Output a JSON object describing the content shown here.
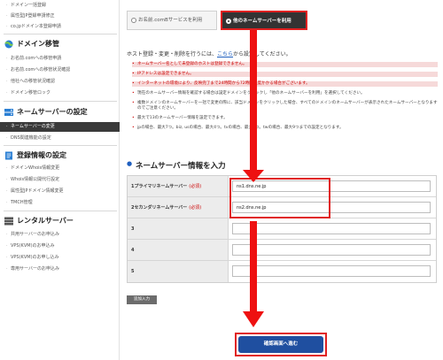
{
  "sidebar": {
    "top_items": [
      "ドメイン一括登録",
      "属性型JP登録申請修正",
      "co.jpドメイン本登録申請"
    ],
    "domain_transfer": {
      "heading": "ドメイン移管",
      "items": [
        "お名前.comへの移管申請",
        "お名前.comへの移管状況確認",
        "他社への移管状況確認",
        "ドメイン移管ロック"
      ]
    },
    "nameserver": {
      "heading": "ネームサーバーの設定",
      "active_item": "ネームサーバーの変更",
      "items": [
        "DNS関連機能の設定"
      ]
    },
    "registration": {
      "heading": "登録情報の設定",
      "items": [
        "ドメインWhois情報変更",
        "Whois情報公開代行設定",
        "属性型JPドメイン情報変更",
        "TMCH管理"
      ]
    },
    "rental": {
      "heading": "レンタルサーバー",
      "items": [
        "共用サーバーのお申込み",
        "VPS(KVM)のお申込み",
        "VPS(KVM)のお申し込み",
        "専用サーバーのお申込み"
      ]
    }
  },
  "tabs": {
    "tab1": "お名前.comBサービスを利用",
    "tab2": "他のネームサーバーを利用"
  },
  "intro": {
    "text_before": "ホスト登録・変更・削除を行うには、",
    "link": "こちら",
    "text_after": "から設定してください。"
  },
  "notes": [
    "ネームサーバー名として未登録のホストは登録できません。",
    "IPアドレスは設定できません。",
    "インターネットの環境により、反映完了まで24時間から72時間程度かかる場合がございます。",
    "現在のネームサーバー情報を確認する場合は設定ドメインをクリックし「他のネームサーバーを利用」を選択してください。",
    "複数ドメインのネームサーバーを一括で変更の際に、該当ドメインをクリックした場合、すべてのドメインのネームサーバーが表示されたネームサーバーとなりますのでご注意ください。",
    "最大で13のネームサーバー情報を設定できます。",
    "jpの場合、最大7つ。biz, usの場合、最大4つ。tvの場合、最大7つ。twの場合、最大9つまでの設定となります。"
  ],
  "section_title": "ネームサーバー情報を入力",
  "ns_rows": [
    {
      "label": "1プライマリネームサーバー",
      "required": "(必須)",
      "value": "ns1.dns.ne.jp"
    },
    {
      "label": "2セカンダリネームサーバー",
      "required": "(必須)",
      "value": "ns2.dns.ne.jp"
    },
    {
      "label": "3",
      "required": "",
      "value": ""
    },
    {
      "label": "4",
      "required": "",
      "value": ""
    },
    {
      "label": "5",
      "required": "",
      "value": ""
    }
  ],
  "add_button": "追加入力",
  "confirm_button": "確認画面へ進む",
  "colors": {
    "highlight_red": "#e02020",
    "arrow_red": "#ee1111",
    "confirm_blue": "#1f4fa0",
    "active_dark": "#333333"
  }
}
